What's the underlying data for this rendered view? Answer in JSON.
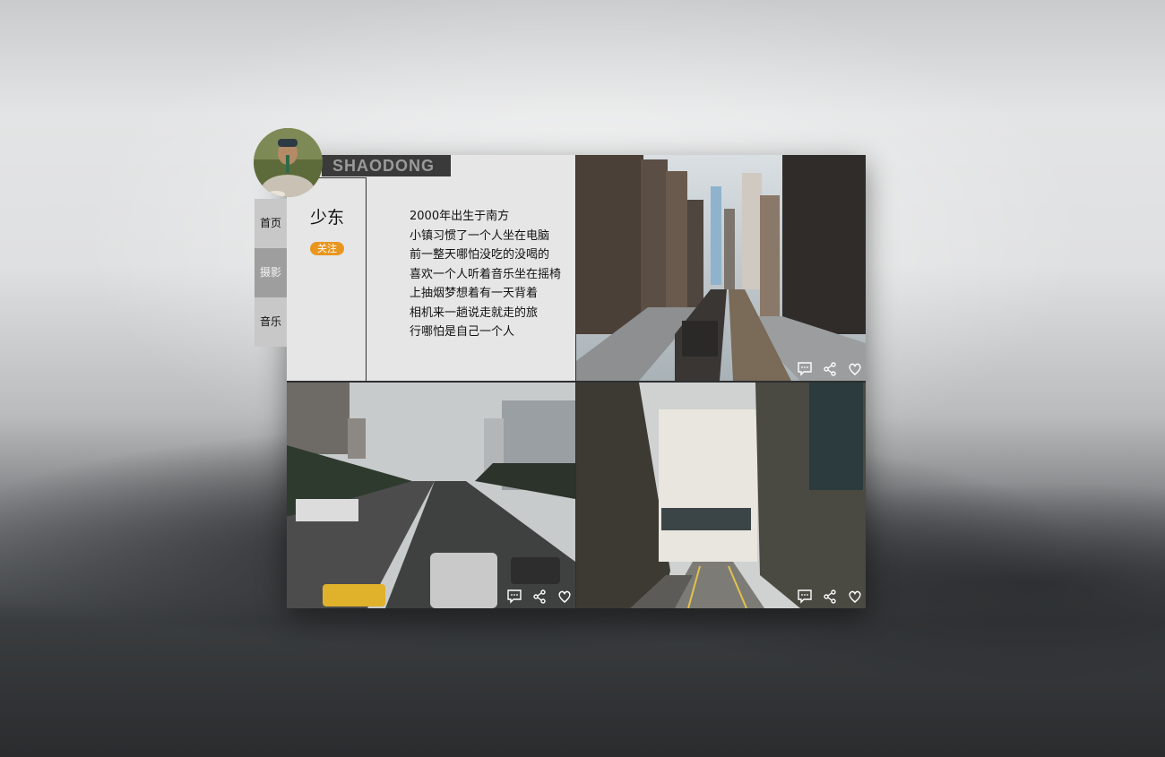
{
  "brand": "SHAODONG",
  "profile": {
    "name": "少东",
    "follow_label": "关注",
    "bio_lines": [
      "2000年出生于南方",
      "小镇习惯了一个人坐在电脑",
      "前一整天哪怕没吃的没喝的",
      "喜欢一个人听着音乐坐在摇椅",
      "上抽烟梦想着有一天背着",
      "相机来一趟说走就走的旅",
      "行哪怕是自己一个人"
    ]
  },
  "nav": {
    "items": [
      {
        "label": "首页",
        "active": false
      },
      {
        "label": "摄影",
        "active": true
      },
      {
        "label": "音乐",
        "active": false
      }
    ]
  },
  "photos": [
    {
      "scene": "elevated train tracks between skyscrapers",
      "actions": [
        "comment-icon",
        "share-icon",
        "heart-icon"
      ]
    },
    {
      "scene": "city highway with traffic and tall buildings",
      "actions": [
        "comment-icon",
        "share-icon",
        "heart-icon"
      ]
    },
    {
      "scene": "narrow old street with brick buildings",
      "actions": [
        "comment-icon",
        "share-icon",
        "heart-icon"
      ]
    }
  ],
  "colors": {
    "accent": "#e8961e",
    "panel": "#e6e6e6",
    "brand_bar": "#3a3a3a",
    "nav_active": "#9e9e9e",
    "nav_default": "#c8c8c8"
  }
}
